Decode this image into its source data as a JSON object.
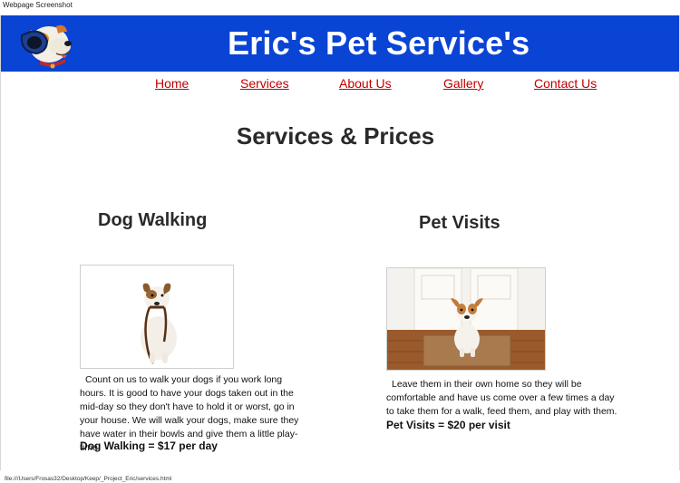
{
  "window": {
    "title": "Webpage Screenshot"
  },
  "header": {
    "site_title": "Eric's Pet Service's",
    "background": "#0a44d4"
  },
  "nav": {
    "items": [
      {
        "label": "Home"
      },
      {
        "label": "Services"
      },
      {
        "label": "About Us"
      },
      {
        "label": "Gallery"
      },
      {
        "label": "Contact Us"
      }
    ],
    "link_color": "#c00000"
  },
  "main": {
    "heading": "Services & Prices",
    "services": [
      {
        "title": "Dog Walking",
        "description": "Count on us to walk your dogs if you work long hours. It is good to have your dogs taken out in the mid-day so they don't have to hold it or worst, go in your house. We will walk your dogs, make sure they have water in their bowls and give them a little play-time.",
        "price": "Dog Walking = $17 per day"
      },
      {
        "title": "Pet Visits",
        "description": "Leave them in their own home so they will be comfortable and have us come over a few times a day to take them for a walk, feed them, and play with them.",
        "price": "Pet Visits = $20 per visit"
      }
    ]
  },
  "status_bar": {
    "url": "file:///Users/Frosas32/Desktop/Keep/_Project_Eric/services.html"
  }
}
